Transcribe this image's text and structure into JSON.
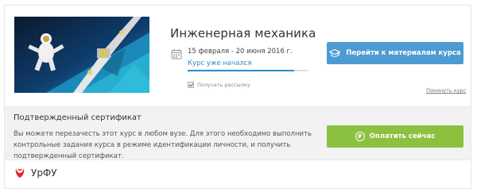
{
  "course": {
    "image_alt": "Astronaut on robotic arm above Earth",
    "title": "Инженерная механика",
    "dates": "15 февраля - 20 июня 2016 г.",
    "status": "Курс уже начался",
    "newsletter_label": "Получать рассылку",
    "newsletter_checked": true,
    "materials_button": "Перейти к материалам курса",
    "unsubscribe_link": "Покинуть курс"
  },
  "certificate": {
    "title": "Подтвержденный сертификат",
    "description": "Вы можете перезачесть этот курс в любом вузе. Для этого необходимо выполнить контрольные задания курса в режиме идентификации личности, и получить подтвержденный сертификат.",
    "pay_button": "Оплатить сейчас"
  },
  "university": {
    "name": "УрФУ"
  },
  "colors": {
    "primary": "#4d9bd3",
    "success": "#8cc03f",
    "link": "#2a8bd1",
    "brand": "#e3262b"
  },
  "icons": [
    "calendar-icon",
    "graduation-cap-icon",
    "coin-icon",
    "urfu-logo-icon",
    "checkbox-check-icon"
  ]
}
